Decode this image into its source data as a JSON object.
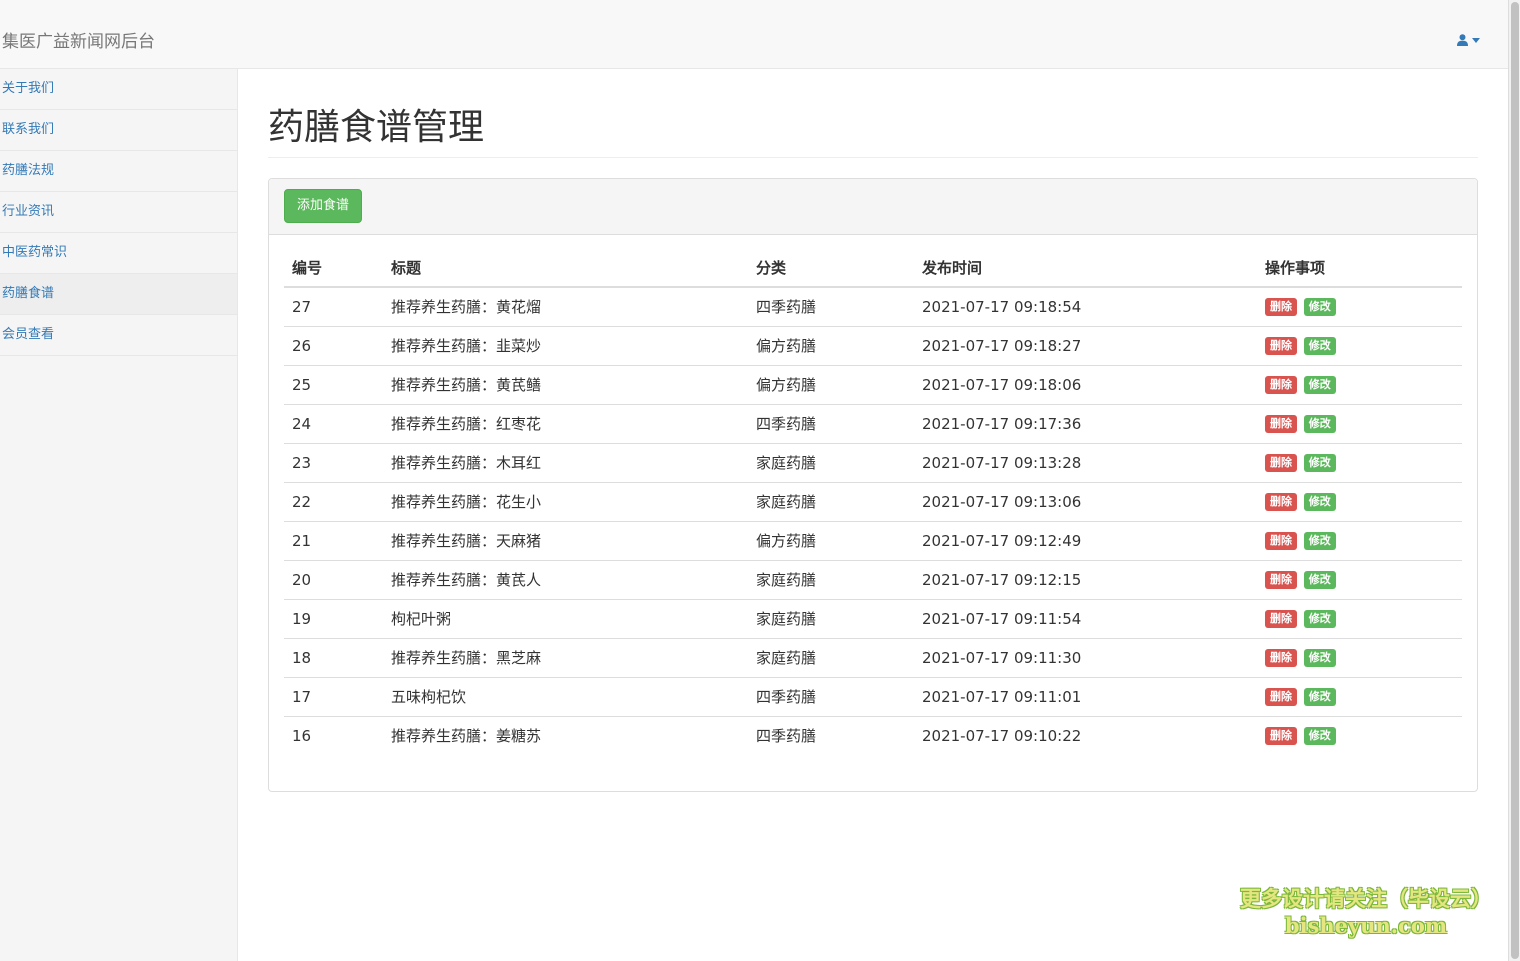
{
  "app": {
    "brand": "集医广益新闻网后台"
  },
  "sidebar": {
    "items": [
      {
        "label": "关于我们",
        "active": false
      },
      {
        "label": "联系我们",
        "active": false
      },
      {
        "label": "药膳法规",
        "active": false
      },
      {
        "label": "行业资讯",
        "active": false
      },
      {
        "label": "中医药常识",
        "active": false
      },
      {
        "label": "药膳食谱",
        "active": true
      },
      {
        "label": "会员查看",
        "active": false
      }
    ]
  },
  "main": {
    "title": "药膳食谱管理",
    "add_button": "添加食谱",
    "table": {
      "headers": [
        "编号",
        "标题",
        "分类",
        "发布时间",
        "操作事项"
      ],
      "delete_label": "删除",
      "edit_label": "修改",
      "rows": [
        {
          "id": "27",
          "title": "推荐养生药膳：黄花熘",
          "category": "四季药膳",
          "time": "2021-07-17 09:18:54"
        },
        {
          "id": "26",
          "title": "推荐养生药膳：韭菜炒",
          "category": "偏方药膳",
          "time": "2021-07-17 09:18:27"
        },
        {
          "id": "25",
          "title": "推荐养生药膳：黄芪鳝",
          "category": "偏方药膳",
          "time": "2021-07-17 09:18:06"
        },
        {
          "id": "24",
          "title": "推荐养生药膳：红枣花",
          "category": "四季药膳",
          "time": "2021-07-17 09:17:36"
        },
        {
          "id": "23",
          "title": "推荐养生药膳：木耳红",
          "category": "家庭药膳",
          "time": "2021-07-17 09:13:28"
        },
        {
          "id": "22",
          "title": "推荐养生药膳：花生小",
          "category": "家庭药膳",
          "time": "2021-07-17 09:13:06"
        },
        {
          "id": "21",
          "title": "推荐养生药膳：天麻猪",
          "category": "偏方药膳",
          "time": "2021-07-17 09:12:49"
        },
        {
          "id": "20",
          "title": "推荐养生药膳：黄芪人",
          "category": "家庭药膳",
          "time": "2021-07-17 09:12:15"
        },
        {
          "id": "19",
          "title": "枸杞叶粥",
          "category": "家庭药膳",
          "time": "2021-07-17 09:11:54"
        },
        {
          "id": "18",
          "title": "推荐养生药膳：黑芝麻",
          "category": "家庭药膳",
          "time": "2021-07-17 09:11:30"
        },
        {
          "id": "17",
          "title": "五味枸杞饮",
          "category": "四季药膳",
          "time": "2021-07-17 09:11:01"
        },
        {
          "id": "16",
          "title": "推荐养生药膳：姜糖苏",
          "category": "四季药膳",
          "time": "2021-07-17 09:10:22"
        }
      ]
    }
  },
  "watermark": {
    "line1": "更多设计请关注（毕设云）",
    "line2": "bisheyun.com"
  },
  "icons": {
    "user": "user-icon",
    "caret": "caret-down-icon"
  },
  "colors": {
    "link": "#337ab7",
    "success": "#5cb85c",
    "danger": "#d9534f"
  }
}
